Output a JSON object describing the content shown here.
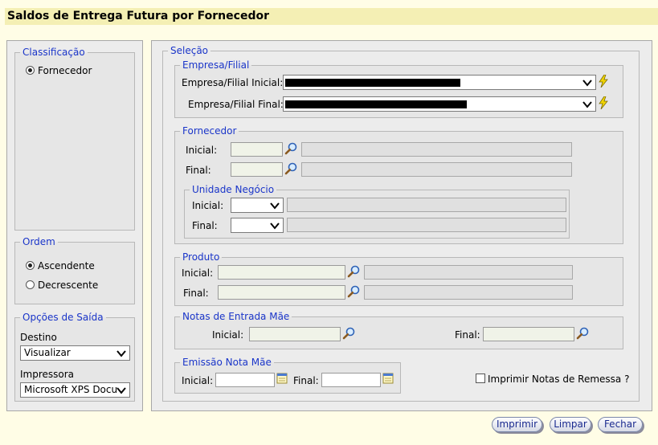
{
  "title": "Saldos de Entrega Futura por Fornecedor",
  "classificacao": {
    "legend": "Classificação",
    "option": "Fornecedor"
  },
  "ordem": {
    "legend": "Ordem",
    "options": [
      "Ascendente",
      "Decrescente"
    ],
    "selected": "Ascendente"
  },
  "opcoes_saida": {
    "legend": "Opções de Saída",
    "destino_label": "Destino",
    "destino_value": "Visualizar",
    "impressora_label": "Impressora",
    "impressora_value": "Microsoft XPS Docu"
  },
  "selecao": {
    "legend": "Seleção",
    "empresa": {
      "legend": "Empresa/Filial",
      "inicial_label": "Empresa/Filial Inicial:",
      "final_label": "Empresa/Filial Final:"
    },
    "fornecedor": {
      "legend": "Fornecedor",
      "inicial_label": "Inicial:",
      "final_label": "Final:",
      "unidade": {
        "legend": "Unidade Negócio",
        "inicial_label": "Inicial:",
        "final_label": "Final:"
      }
    },
    "produto": {
      "legend": "Produto",
      "inicial_label": "Inicial:",
      "final_label": "Final:"
    },
    "notas": {
      "legend": "Notas de Entrada Mãe",
      "inicial_label": "Inicial:",
      "final_label": "Final:"
    },
    "emissao": {
      "legend": "Emissão Nota Mãe",
      "inicial_label": "Inicial:",
      "final_label": "Final:"
    },
    "imprimir_remessa_label": "Imprimir Notas de Remessa ?"
  },
  "buttons": {
    "imprimir": "Imprimir",
    "limpar": "Limpar",
    "fechar": "Fechar"
  },
  "colors": {
    "legend": "#1a35c9",
    "title_bar": "#f4efb4",
    "background": "#fffde6"
  }
}
